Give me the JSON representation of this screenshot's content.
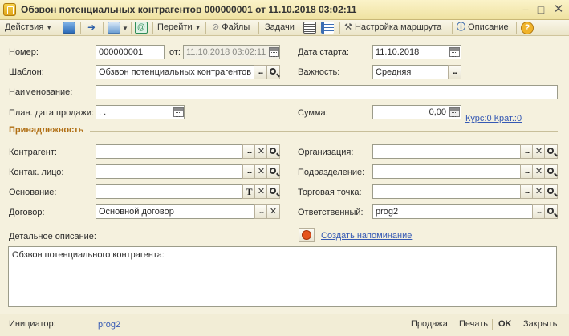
{
  "window": {
    "title": "Обзвон потенциальных контрагентов 000000001 от 11.10.2018 03:02:11",
    "minimize": "−",
    "maximize": "□",
    "close": "✕"
  },
  "toolbar": {
    "actions": "Действия",
    "goto": "Перейти",
    "files": "Файлы",
    "tasks": "Задачи",
    "route_settings": "Настройка маршрута",
    "description": "Описание",
    "help": "?"
  },
  "form": {
    "number_label": "Номер:",
    "number_value": "000000001",
    "from_label": "от:",
    "from_value": "11.10.2018 03:02:11",
    "start_date_label": "Дата старта:",
    "start_date_value": "11.10.2018",
    "template_label": "Шаблон:",
    "template_value": "Обзвон потенциальных контрагентов",
    "importance_label": "Важность:",
    "importance_value": "Средняя",
    "name_label": "Наименование:",
    "name_value": "",
    "plan_date_label": "План. дата продажи:",
    "plan_date_value": " .  .",
    "sum_label": "Сумма:",
    "sum_value": "0,00",
    "rate_link": "Курс:0 Крат.:0"
  },
  "section": {
    "title": "Принадлежность",
    "counterparty_label": "Контрагент:",
    "counterparty_value": "",
    "organization_label": "Организация:",
    "organization_value": "",
    "contact_label": "Контак. лицо:",
    "contact_value": "",
    "division_label": "Подразделение:",
    "division_value": "",
    "basis_label": "Основание:",
    "basis_value": "",
    "outlet_label": "Торговая точка:",
    "outlet_value": "",
    "contract_label": "Договор:",
    "contract_value": "Основной договор",
    "responsible_label": "Ответственный:",
    "responsible_value": "prog2"
  },
  "details": {
    "label": "Детальное описание:",
    "reminder_link": "Создать напоминание",
    "text": "Обзвон потенциального контрагента:"
  },
  "footer": {
    "initiator_label": "Инициатор:",
    "initiator_value": "prog2",
    "sale_button": "Продажа",
    "print_button": "Печать",
    "ok_button": "OK",
    "close_button": "Закрыть"
  },
  "colors": {
    "title_bar": "#efe2a1",
    "background": "#f5f1de",
    "section_title": "#b06e13",
    "link": "#3559b4"
  }
}
